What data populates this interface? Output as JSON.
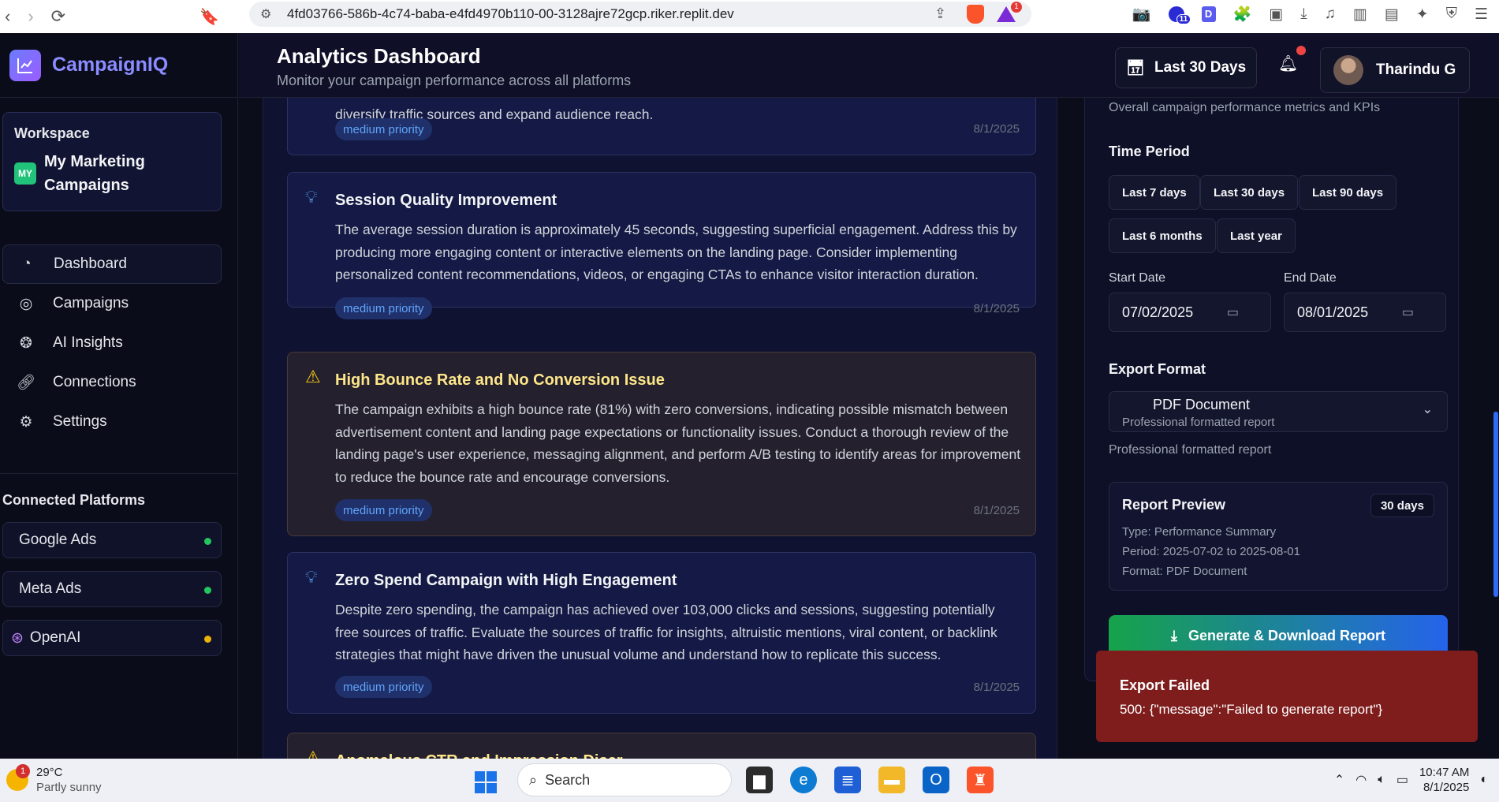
{
  "browser": {
    "url": "4fd03766-586b-4c74-baba-e4fd4970b110-00-3128ajre72gcp.riker.replit.dev",
    "notification_badge": "1",
    "extension_badge": "11"
  },
  "sidebar": {
    "brand": "CampaignIQ",
    "workspace_label": "Workspace",
    "workspace_initials": "MY",
    "workspace_name": "My Marketing Campaigns",
    "menu": [
      {
        "label": "Dashboard",
        "icon": "pie-chart-icon",
        "active": true
      },
      {
        "label": "Campaigns",
        "icon": "target-icon"
      },
      {
        "label": "AI Insights",
        "icon": "brain-icon"
      },
      {
        "label": "Connections",
        "icon": "link-icon"
      },
      {
        "label": "Settings",
        "icon": "gear-icon"
      }
    ],
    "connected_platforms_title": "Connected Platforms",
    "platforms": [
      {
        "label": "Google Ads",
        "status_color": "#22c55e"
      },
      {
        "label": "Meta Ads",
        "status_color": "#22c55e"
      },
      {
        "label": "OpenAI",
        "status_color": "#eab308"
      }
    ]
  },
  "header": {
    "title": "Analytics Dashboard",
    "subtitle": "Monitor your campaign performance across all platforms",
    "date_range": "Last 30 Days",
    "user_name": "Tharindu G"
  },
  "insights": [
    {
      "title": "",
      "body": "diversify traffic sources and expand audience reach.",
      "priority": "medium priority",
      "date": "8/1/2025",
      "kind": "tip"
    },
    {
      "title": "Session Quality Improvement",
      "body": "The average session duration is approximately 45 seconds, suggesting superficial engagement. Address this by producing more engaging content or interactive elements on the landing page. Consider implementing personalized content recommendations, videos, or engaging CTAs to enhance visitor interaction duration.",
      "priority": "medium priority",
      "date": "8/1/2025",
      "kind": "tip"
    },
    {
      "title": "High Bounce Rate and No Conversion Issue",
      "body": "The campaign exhibits a high bounce rate (81%) with zero conversions, indicating possible mismatch between advertisement content and landing page expectations or functionality issues. Conduct a thorough review of the landing page's user experience, messaging alignment, and perform A/B testing to identify areas for improvement to reduce the bounce rate and encourage conversions.",
      "priority": "medium priority",
      "date": "8/1/2025",
      "kind": "warning"
    },
    {
      "title": "Zero Spend Campaign with High Engagement",
      "body": "Despite zero spending, the campaign has achieved over 103,000 clicks and sessions, suggesting potentially free sources of traffic. Evaluate the sources of traffic for insights, altruistic mentions, viral content, or backlink strategies that might have driven the unusual volume and understand how to replicate this success.",
      "priority": "medium priority",
      "date": "8/1/2025",
      "kind": "tip"
    },
    {
      "title": "Anomalous CTR and Impression Discr",
      "kind": "warning"
    }
  ],
  "export_panel": {
    "description": "Overall campaign performance metrics and KPIs",
    "time_period_label": "Time Period",
    "periods": [
      "Last 7 days",
      "Last 30 days",
      "Last 90 days",
      "Last 6 months",
      "Last year"
    ],
    "start_date_label": "Start Date",
    "start_date": "07/02/2025",
    "end_date_label": "End Date",
    "end_date": "08/01/2025",
    "export_format_label": "Export Format",
    "format_value": "PDF Document",
    "format_desc": "Professional formatted report",
    "format_note": "Professional formatted report",
    "preview_title": "Report Preview",
    "preview_days": "30 days",
    "preview_type": "Type: Performance Summary",
    "preview_period": "Period: 2025-07-02 to 2025-08-01",
    "preview_format": "Format: PDF Document",
    "generate_label": "Generate & Download Report"
  },
  "toast": {
    "title": "Export Failed",
    "message": "500: {\"message\":\"Failed to generate report\"}"
  },
  "taskbar": {
    "weather_temp": "29°C",
    "weather_desc": "Partly sunny",
    "weather_badge": "1",
    "search_placeholder": "Search",
    "time": "10:47 AM",
    "date": "8/1/2025"
  }
}
